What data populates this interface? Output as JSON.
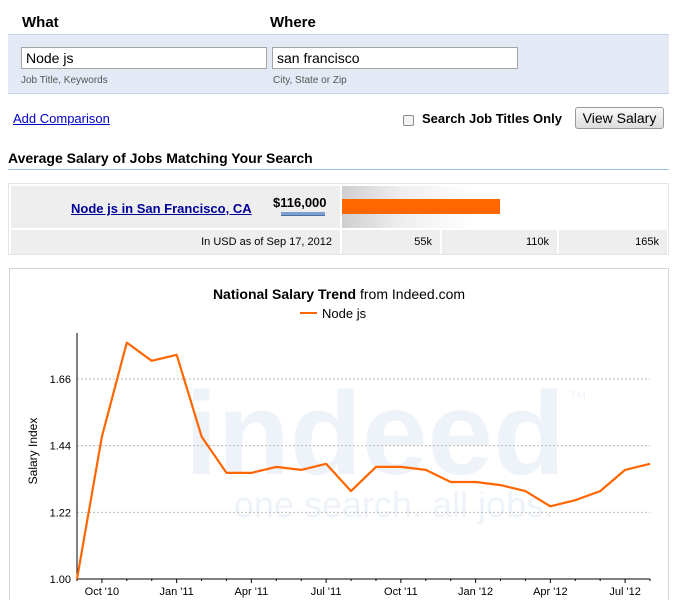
{
  "search": {
    "what_label": "What",
    "where_label": "Where",
    "what_value": "Node js",
    "where_value": "san francisco",
    "what_hint": "Job Title, Keywords",
    "where_hint": "City, State or Zip",
    "add_comparison": "Add Comparison",
    "titles_only_label": "Search Job Titles Only",
    "titles_only_checked": false,
    "submit_label": "View Salary"
  },
  "section": {
    "title": "Average Salary of Jobs Matching Your Search"
  },
  "salary_table": {
    "job_link": "Node js in San Francisco, CA",
    "salary": "$116,000",
    "salary_number": 116000,
    "scale_max": 165000,
    "as_of": "In USD as of Sep 17, 2012",
    "bar_color": "#ff6600",
    "scale_labels": [
      "55k",
      "110k",
      "165k"
    ]
  },
  "chart": {
    "title_bold": "National Salary Trend",
    "title_rest": " from Indeed.com",
    "watermark_word": "indeed",
    "watermark_tag": "one search. all jobs.",
    "watermark_tm": "TM"
  },
  "chart_data": {
    "type": "line",
    "ylabel": "Salary Index",
    "xlabel": "",
    "ylim": [
      1.0,
      1.66
    ],
    "yticks": [
      "1.00",
      "1.22",
      "1.44",
      "1.66"
    ],
    "xticks": [
      "Oct '10",
      "Jan '11",
      "Apr '11",
      "Jul '11",
      "Oct '11",
      "Jan '12",
      "Apr '12",
      "Jul '12"
    ],
    "grid": true,
    "legend_position": "top",
    "series": [
      {
        "name": "Node js",
        "color": "#ff6600",
        "values": [
          1.0,
          1.47,
          1.78,
          1.72,
          1.74,
          1.47,
          1.35,
          1.35,
          1.37,
          1.36,
          1.38,
          1.29,
          1.37,
          1.37,
          1.36,
          1.32,
          1.32,
          1.31,
          1.29,
          1.24,
          1.26,
          1.29,
          1.36,
          1.38
        ]
      }
    ]
  }
}
